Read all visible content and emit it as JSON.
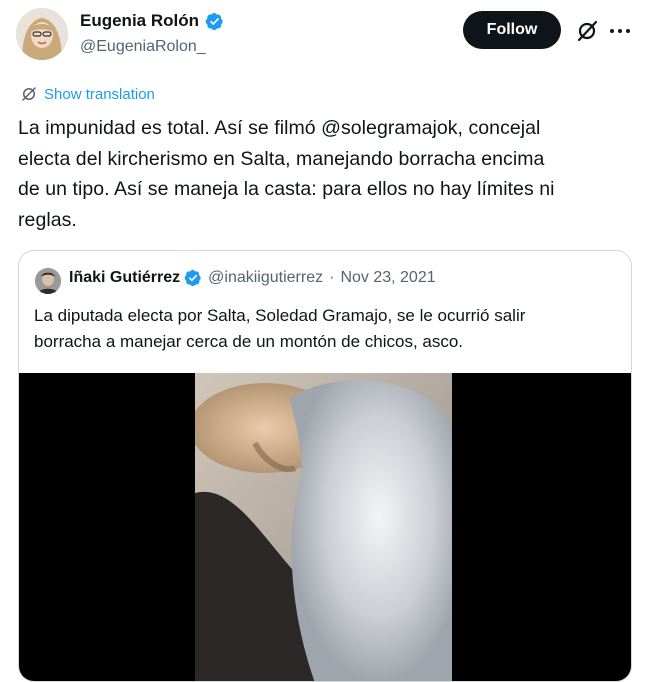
{
  "author": {
    "name": "Eugenia Rolón",
    "handle": "@EugeniaRolon_",
    "verified": true
  },
  "actions": {
    "follow_label": "Follow",
    "grok_icon": "grok-icon",
    "more_icon": "more-icon"
  },
  "translate": {
    "icon": "translate-icon",
    "label": "Show translation"
  },
  "tweet": {
    "line1": "La impunidad es total. Así se filmó @solegramajok, concejal",
    "line2": "electa del kircherismo en Salta, manejando borracha encima",
    "line3": "de un tipo. Así se maneja la casta: para ellos no hay límites ni",
    "line4": "reglas."
  },
  "quote": {
    "name": "Iñaki Gutiérrez",
    "handle": "@inakiigutierrez",
    "separator": "·",
    "date": "Nov 23, 2021",
    "line1": "La diputada electa por Salta, Soledad Gramajo, se le ocurrió salir",
    "line2": "borracha a manejar cerca de un montón de chicos, asco.",
    "media": "video"
  },
  "colors": {
    "accent": "#1d9bf0",
    "text": "#0f1419",
    "secondary": "#536471",
    "border": "#cfd9de"
  }
}
